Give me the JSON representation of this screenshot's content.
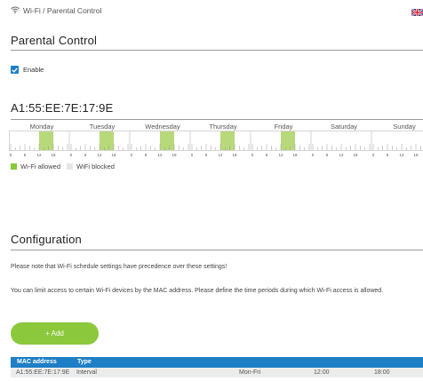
{
  "breadcrumb": {
    "text": "Wi-Fi / Parental Control",
    "icon": "wifi-icon"
  },
  "language_flag": "uk-flag-icon",
  "sections": {
    "parental_control": {
      "title": "Parental Control"
    },
    "device": {
      "title": "A1:55:EE:7E:17:9E"
    },
    "configuration": {
      "title": "Configuration"
    }
  },
  "enable": {
    "label": "Enable",
    "checked": true
  },
  "schedule": {
    "days": [
      "Monday",
      "Tuesday",
      "Wednesday",
      "Thursday",
      "Friday",
      "Saturday",
      "Sunday"
    ],
    "hour_ticks": [
      "0",
      "6",
      "12",
      "18"
    ],
    "allowed": [
      {
        "day": "Monday",
        "from": "12:00",
        "to": "18:00"
      },
      {
        "day": "Tuesday",
        "from": "12:00",
        "to": "18:00"
      },
      {
        "day": "Wednesday",
        "from": "12:00",
        "to": "18:00"
      },
      {
        "day": "Thursday",
        "from": "12:00",
        "to": "18:00"
      },
      {
        "day": "Friday",
        "from": "12:00",
        "to": "18:00"
      }
    ],
    "colors": {
      "allowed": "#b8d97a",
      "blocked": "#ececec"
    }
  },
  "legend": {
    "allowed": "Wi-Fi allowed",
    "blocked": "WiFi blocked"
  },
  "notes": {
    "precedence": "Please note that Wi-Fi schedule settings have precedence over these settings!",
    "instructions": "You can limit access to certain Wi-Fi devices by the MAC address. Please define the time periods during which Wi-Fi access is allowed."
  },
  "add_button": {
    "label": "+ Add"
  },
  "table": {
    "headers": [
      "MAC address",
      "Type"
    ],
    "rows": [
      {
        "mac": "A1:55:EE:7E:17:9E",
        "type": "Interval",
        "days": "Mon-Fri",
        "from": "12:00",
        "to": "18:00"
      }
    ]
  },
  "colors": {
    "accent": "#1e7fc6",
    "add_button": "#8bc83b"
  }
}
